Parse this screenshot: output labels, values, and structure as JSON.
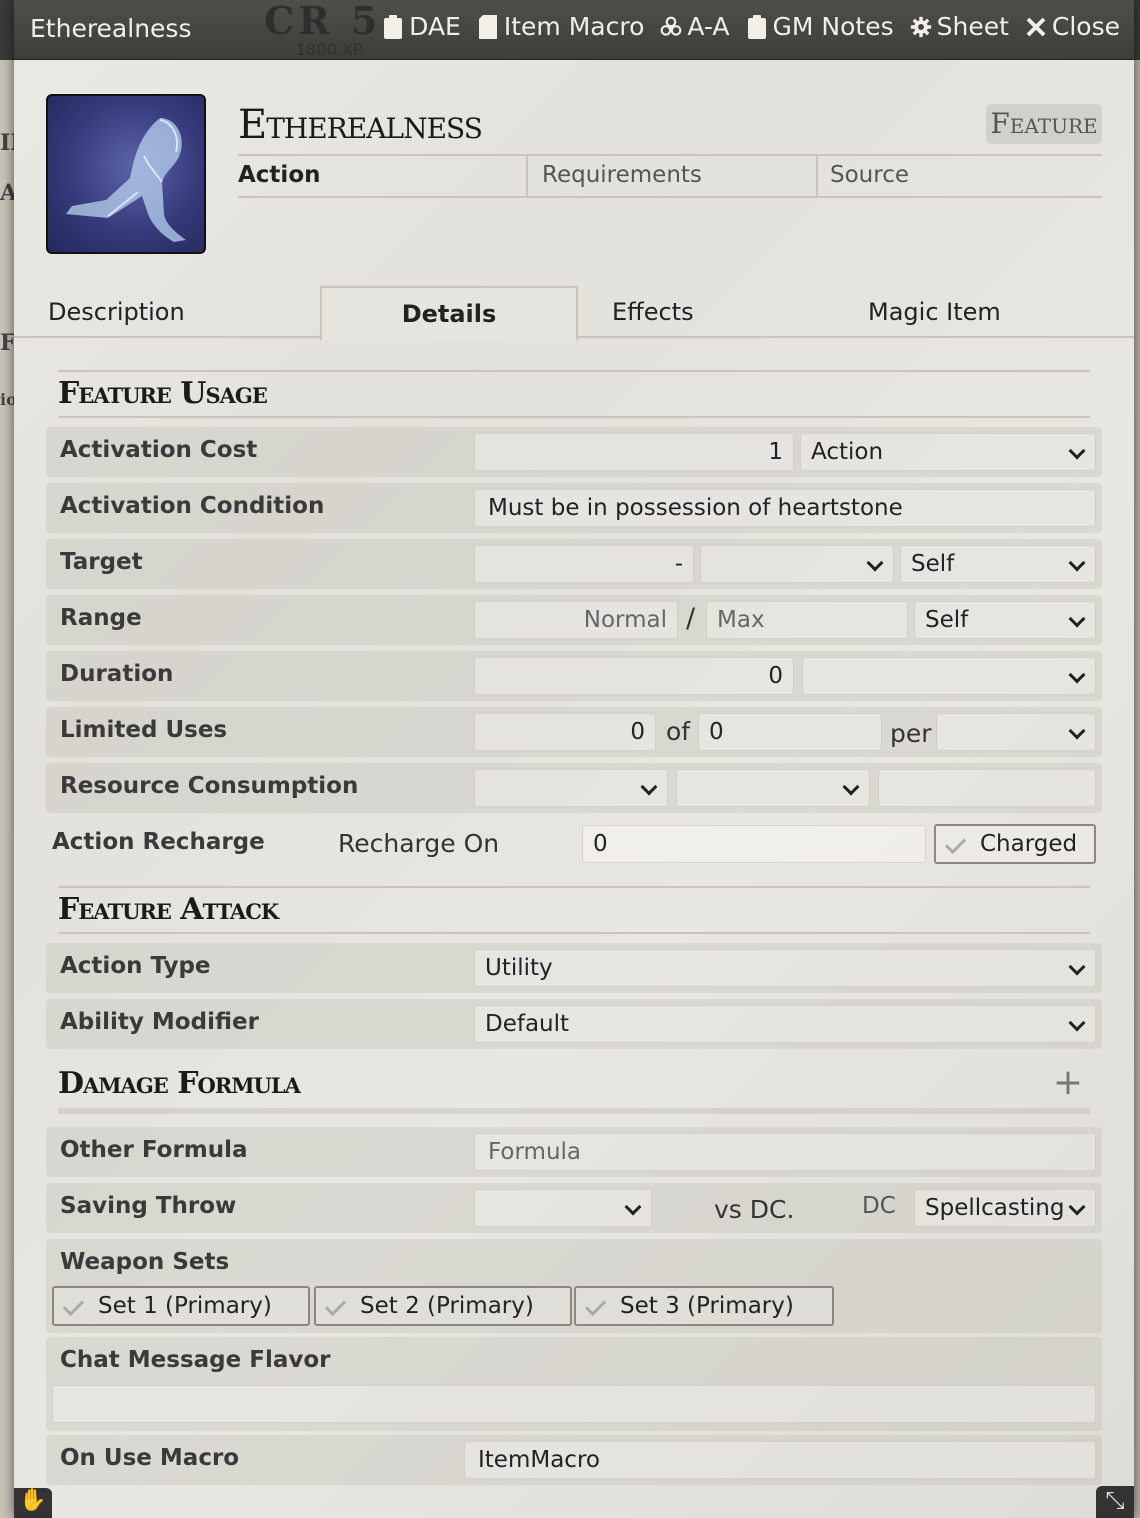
{
  "window": {
    "title": "Etherealness",
    "cr_label": "CR 5",
    "xp_label": "1800 XP",
    "controls": [
      {
        "id": "dae",
        "label": "DAE",
        "icon": "clipboard-icon"
      },
      {
        "id": "item-macro",
        "label": "Item Macro",
        "icon": "sd-card-icon"
      },
      {
        "id": "a-a",
        "label": "A-A",
        "icon": "biohazard-icon"
      },
      {
        "id": "gm-notes",
        "label": "GM Notes",
        "icon": "clipboard-icon"
      },
      {
        "id": "sheet",
        "label": "Sheet",
        "icon": "gear-icon"
      },
      {
        "id": "close",
        "label": "Close",
        "icon": "close-icon"
      }
    ]
  },
  "item": {
    "name": "Etherealness",
    "type": "Feature",
    "summary": {
      "activation": "Action",
      "requirements": "Requirements",
      "source": "Source"
    }
  },
  "tabs": [
    {
      "label": "Description",
      "active": false
    },
    {
      "label": "Details",
      "active": true
    },
    {
      "label": "Effects",
      "active": false
    },
    {
      "label": "Magic Item",
      "active": false
    }
  ],
  "feature_usage": {
    "header": "Feature Usage",
    "activation_cost": {
      "label": "Activation Cost",
      "value": "1",
      "type": "Action"
    },
    "activation_condition": {
      "label": "Activation Condition",
      "value": "Must be in possession of  heartstone"
    },
    "target": {
      "label": "Target",
      "value": "-",
      "units": "",
      "type": "Self"
    },
    "range": {
      "label": "Range",
      "normal_placeholder": "Normal",
      "separator": "/",
      "max_placeholder": "Max",
      "units": "Self"
    },
    "duration": {
      "label": "Duration",
      "value": "0",
      "units": ""
    },
    "limited_uses": {
      "label": "Limited Uses",
      "value": "0",
      "of_label": "of",
      "max": "0",
      "per_label": "per",
      "per": ""
    },
    "resource_consumption": {
      "label": "Resource Consumption",
      "type": "",
      "target": "",
      "amount": ""
    },
    "action_recharge": {
      "label": "Action Recharge",
      "recharge_on_label": "Recharge On",
      "value": "0",
      "charged_label": "Charged"
    }
  },
  "feature_attack": {
    "header": "Feature Attack",
    "action_type": {
      "label": "Action Type",
      "value": "Utility"
    },
    "ability_modifier": {
      "label": "Ability Modifier",
      "value": "Default"
    }
  },
  "damage_formula": {
    "header": "Damage Formula",
    "add_icon": "plus-icon",
    "other_formula": {
      "label": "Other Formula",
      "placeholder": "Formula"
    },
    "saving_throw": {
      "label": "Saving Throw",
      "ability": "",
      "vs_label": "vs DC.",
      "dc_label": "DC",
      "scaling": "Spellcasting"
    },
    "weapon_sets": {
      "label": "Weapon Sets",
      "sets": [
        "Set 1 (Primary)",
        "Set 2 (Primary)",
        "Set 3 (Primary)"
      ]
    },
    "chat_flavor": {
      "label": "Chat Message Flavor",
      "value": ""
    },
    "on_use_macro": {
      "label": "On Use Macro",
      "value": "ItemMacro"
    }
  },
  "colors": {
    "header_bg": "#45453f",
    "portrait_bg": "#353a7a",
    "text": "#222222"
  }
}
